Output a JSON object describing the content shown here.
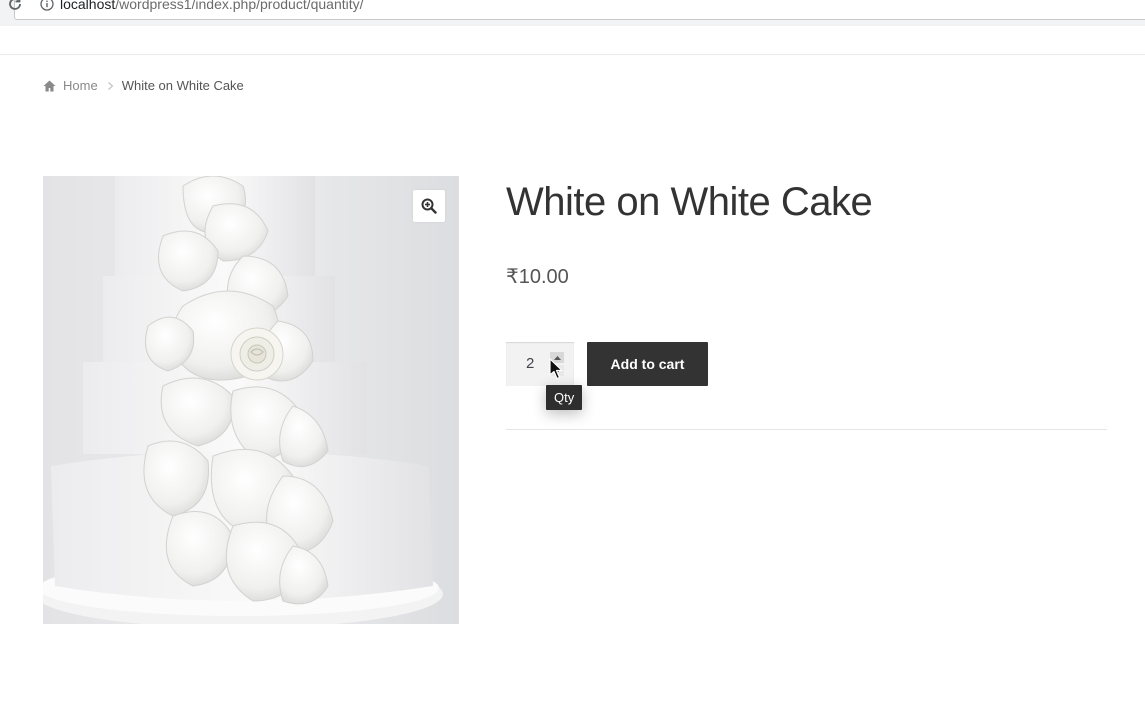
{
  "browser": {
    "url_host": "localhost",
    "url_path": "/wordpress1/index.php/product/quantity/"
  },
  "breadcrumb": {
    "home_label": "Home",
    "current_label": "White on White Cake"
  },
  "gallery": {
    "image_icon": "cake-image",
    "zoom_icon": "zoom-in-icon"
  },
  "product": {
    "title": "White on White Cake",
    "price": "₹10.00"
  },
  "cart_form": {
    "quantity_value": "2",
    "tooltip": "Qty",
    "add_to_cart_label": "Add to cart"
  },
  "colors": {
    "button_bg": "#333333",
    "button_text": "#ffffff",
    "tooltip_bg": "#2e2e2e"
  }
}
